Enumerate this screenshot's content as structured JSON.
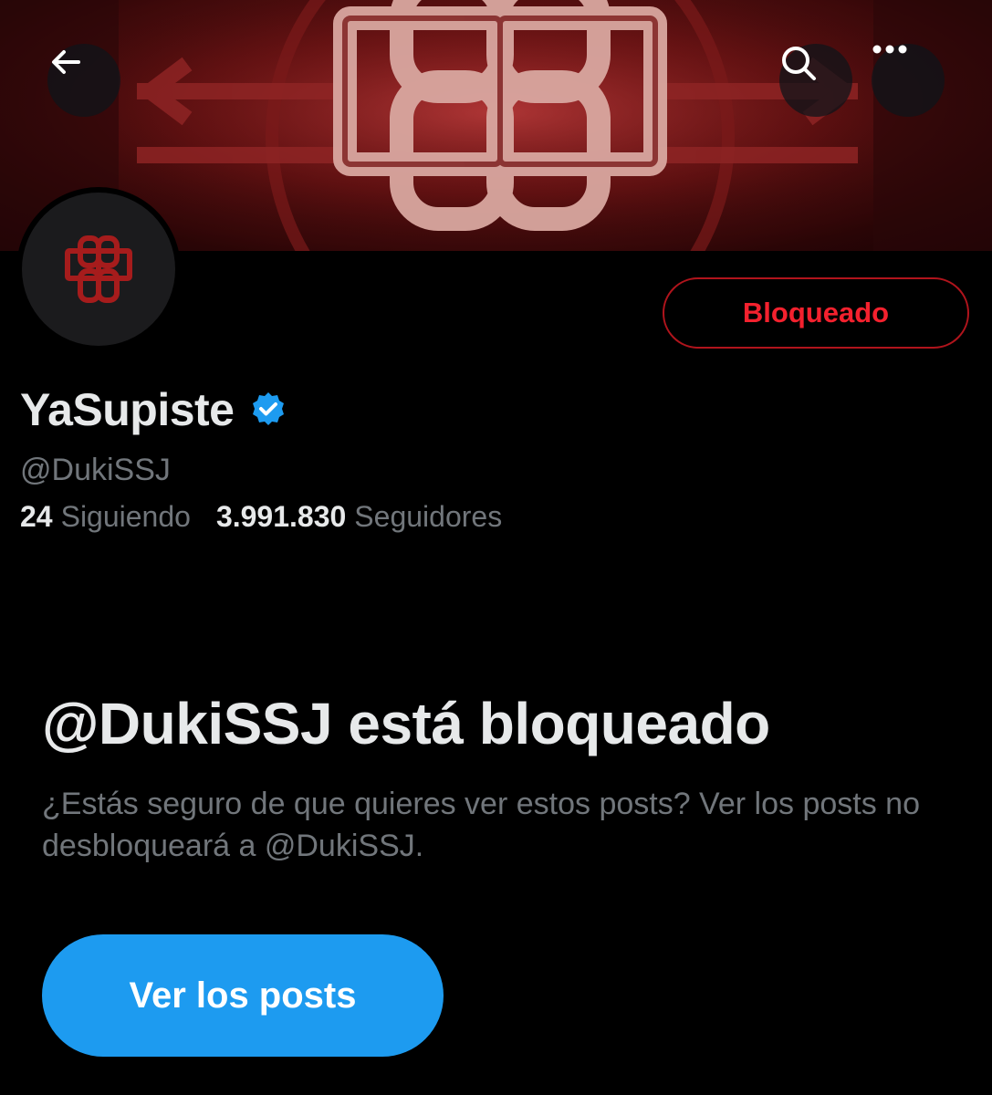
{
  "header": {
    "back_icon": "arrow-left-icon",
    "search_icon": "search-icon",
    "more_icon": "more-horizontal-icon"
  },
  "profile": {
    "display_name": "YaSupiste",
    "verified": true,
    "handle": "@DukiSSJ",
    "blocked_button_label": "Bloqueado",
    "following_count": "24",
    "following_label": "Siguiendo",
    "followers_count": "3.991.830",
    "followers_label": "Seguidores"
  },
  "blocked_notice": {
    "title": "@DukiSSJ está bloqueado",
    "description": "¿Estás seguro de que quieres ver estos posts? Ver los posts no desbloqueará a @DukiSSJ.",
    "view_posts_label": "Ver los posts"
  },
  "colors": {
    "background": "#000000",
    "accent_blue": "#1d9bf0",
    "blocked_red": "#f4212e",
    "secondary_text": "#71767b",
    "primary_text": "#e7e9ea"
  }
}
